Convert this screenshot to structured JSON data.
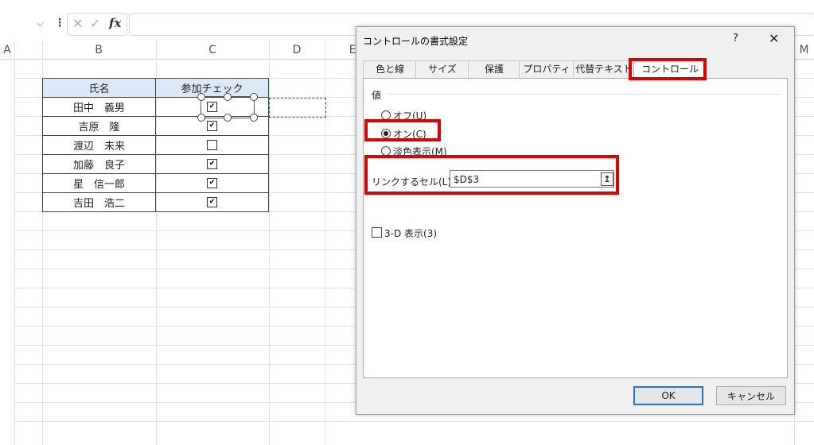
{
  "formula_bar": {
    "fx_label": "fx",
    "cancel_glyph": "✕",
    "enter_glyph": "✓"
  },
  "columns": [
    "A",
    "B",
    "C",
    "D",
    "E",
    "M"
  ],
  "table": {
    "headers": [
      "氏名",
      "参加チェック"
    ],
    "rows": [
      {
        "name": "田中　義男",
        "checked": true
      },
      {
        "name": "吉原　隆",
        "checked": true
      },
      {
        "name": "渡辺　未来",
        "checked": false
      },
      {
        "name": "加藤　良子",
        "checked": true
      },
      {
        "name": "星　信一郎",
        "checked": true
      },
      {
        "name": "吉田　浩二",
        "checked": true
      }
    ]
  },
  "dialog": {
    "title": "コントロールの書式設定",
    "help": "?",
    "close": "✕",
    "tabs": [
      "色と線",
      "サイズ",
      "保護",
      "プロパティ",
      "代替テキスト",
      "コントロール"
    ],
    "active_tab": "コントロール",
    "value_group": "値",
    "options": {
      "off": "オフ(U)",
      "on": "オン(C)",
      "mixed": "淡色表示(M)"
    },
    "selected_option": "on",
    "link_label": "リンクするセル(L):",
    "link_value": "$D$3",
    "three_d": "3-D 表示(3)",
    "ok": "OK",
    "cancel": "キャンセル"
  },
  "highlight_color": "#e00000"
}
